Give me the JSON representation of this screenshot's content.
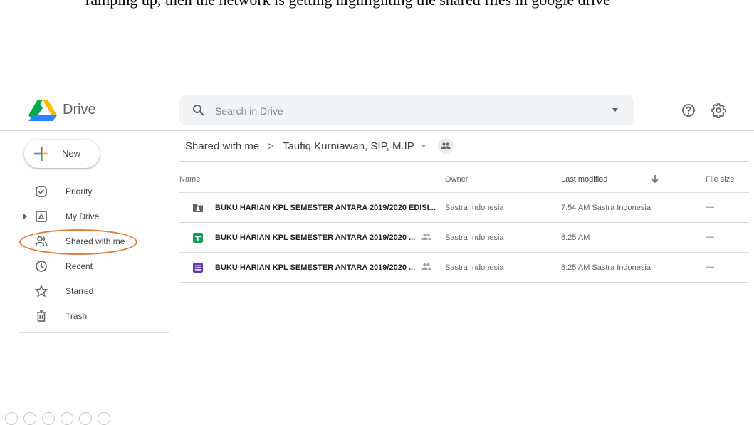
{
  "caption_fragment": "ramping up, then the network is getting highlighting the shared files in google drive",
  "app": {
    "title": "Drive"
  },
  "search": {
    "placeholder": "Search in Drive"
  },
  "toolbar": {
    "help_icon": "help-circle-icon",
    "settings_icon": "gear-icon"
  },
  "new_button": {
    "label": "New"
  },
  "sidebar": {
    "items": [
      {
        "label": "Priority",
        "icon": "priority-check-icon"
      },
      {
        "label": "My Drive",
        "icon": "my-drive-icon"
      },
      {
        "label": "Shared with me",
        "icon": "shared-people-icon"
      },
      {
        "label": "Recent",
        "icon": "clock-icon"
      },
      {
        "label": "Starred",
        "icon": "star-icon"
      },
      {
        "label": "Trash",
        "icon": "trash-icon"
      }
    ],
    "highlight_color": "#e07b39"
  },
  "breadcrumb": {
    "root": "Shared with me",
    "separator": ">",
    "current": "Taufiq Kurniawan, SIP, M.IP"
  },
  "table": {
    "columns": {
      "name": "Name",
      "owner": "Owner",
      "last_modified": "Last modified",
      "file_size": "File size"
    },
    "rows": [
      {
        "name": "BUKU HARIAN KPL SEMESTER ANTARA 2019/2020 EDISI...",
        "type": "shared-folder",
        "color": "#5f6368",
        "owner": "Sastra Indonesia",
        "modified": "7:54 AM Sastra Indonesia",
        "size": "—"
      },
      {
        "name": "BUKU HARIAN KPL SEMESTER ANTARA 2019/2020 ...",
        "type": "sheets",
        "color": "#0f9d58",
        "owner": "Sastra Indonesia",
        "modified": "8:25 AM",
        "size": "—"
      },
      {
        "name": "BUKU HARIAN KPL SEMESTER ANTARA 2019/2020 ...",
        "type": "forms",
        "color": "#673ab7",
        "owner": "Sastra Indonesia",
        "modified": "8:25 AM Sastra Indonesia",
        "size": "—"
      }
    ]
  }
}
